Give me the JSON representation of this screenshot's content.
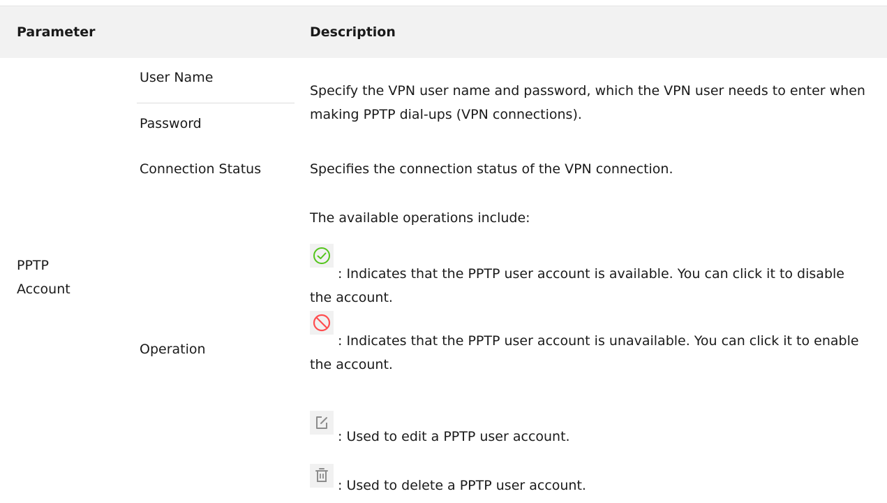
{
  "header": {
    "parameter": "Parameter",
    "description": "Description"
  },
  "group": {
    "label": "PPTP Account"
  },
  "rows": {
    "user_name": "User Name",
    "password": "Password",
    "user_pass_desc": "Specify the VPN user name and password, which the VPN user needs to enter when making PPTP dial-ups (VPN connections).",
    "connection_status": "Connection Status",
    "connection_status_desc": "Specifies the connection status of the VPN connection.",
    "operation": "Operation",
    "operation_intro": "The available operations include:"
  },
  "operations": {
    "enabled": {
      "icon": "check-circle-icon",
      "color": "#52c41a",
      "text": ": Indicates that the PPTP user account is available. You can click it to disable the account."
    },
    "disabled": {
      "icon": "no-entry-icon",
      "color": "#ff4d4f",
      "text": ": Indicates that the PPTP user account is unavailable. You can click it to enable the account."
    },
    "edit": {
      "icon": "edit-icon",
      "color": "#8c8c8c",
      "text": ": Used to edit a PPTP user account."
    },
    "delete": {
      "icon": "trash-icon",
      "color": "#8c8c8c",
      "text": ": Used to delete a PPTP user account."
    }
  }
}
